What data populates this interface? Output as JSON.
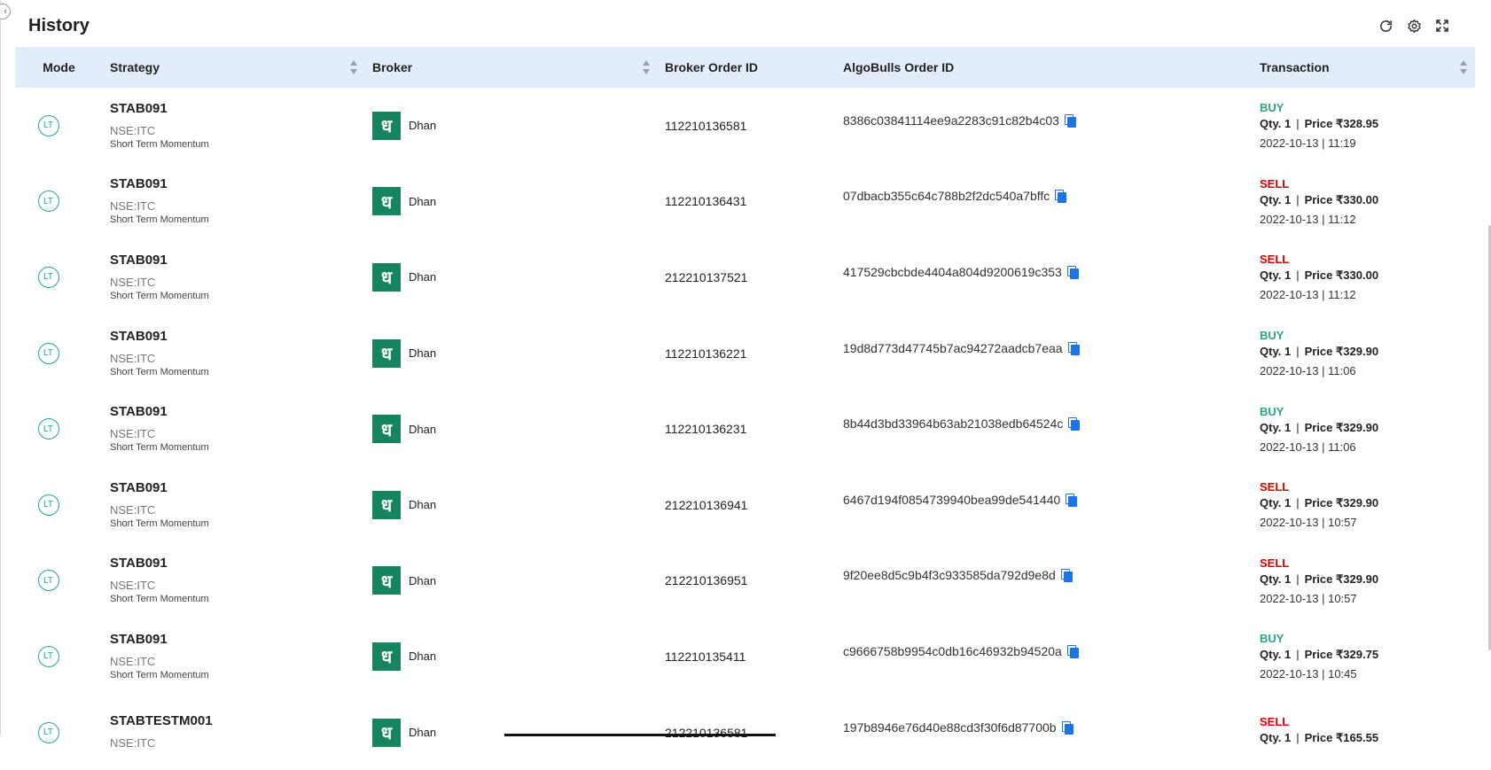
{
  "title": "History",
  "header_icons": [
    "refresh-icon",
    "gear-icon",
    "fullscreen-icon"
  ],
  "colors": {
    "header_bg": "#e3ecfa",
    "buy": "#2aa876",
    "sell": "#e00000",
    "broker_logo": "#16855d",
    "mode_badge": "#1fa59b",
    "copy_icon": "#1a73e8"
  },
  "columns": {
    "mode": "Mode",
    "strategy": "Strategy",
    "broker": "Broker",
    "broker_order_id": "Broker Order ID",
    "algobulls_order_id": "AlgoBulls Order ID",
    "transaction": "Transaction"
  },
  "qty_label": "Qty.",
  "price_label": "Price",
  "rows": [
    {
      "mode": "LT",
      "strategy": "STAB091",
      "instrument": "NSE:ITC",
      "description": "Short Term Momentum",
      "broker_glyph": "ध",
      "broker": "Dhan",
      "broker_order_id": "112210136581",
      "algobulls_order_id": "8386c03841114ee9a2283c91c82b4c03",
      "type": "BUY",
      "qty": "1",
      "price": "₹328.95",
      "datetime": "2022-10-13 | 11:19"
    },
    {
      "mode": "LT",
      "strategy": "STAB091",
      "instrument": "NSE:ITC",
      "description": "Short Term Momentum",
      "broker_glyph": "ध",
      "broker": "Dhan",
      "broker_order_id": "112210136431",
      "algobulls_order_id": "07dbacb355c64c788b2f2dc540a7bffc",
      "type": "SELL",
      "qty": "1",
      "price": "₹330.00",
      "datetime": "2022-10-13 | 11:12"
    },
    {
      "mode": "LT",
      "strategy": "STAB091",
      "instrument": "NSE:ITC",
      "description": "Short Term Momentum",
      "broker_glyph": "ध",
      "broker": "Dhan",
      "broker_order_id": "212210137521",
      "algobulls_order_id": "417529cbcbde4404a804d9200619c353",
      "type": "SELL",
      "qty": "1",
      "price": "₹330.00",
      "datetime": "2022-10-13 | 11:12"
    },
    {
      "mode": "LT",
      "strategy": "STAB091",
      "instrument": "NSE:ITC",
      "description": "Short Term Momentum",
      "broker_glyph": "ध",
      "broker": "Dhan",
      "broker_order_id": "112210136221",
      "algobulls_order_id": "19d8d773d47745b7ac94272aadcb7eaa",
      "type": "BUY",
      "qty": "1",
      "price": "₹329.90",
      "datetime": "2022-10-13 | 11:06"
    },
    {
      "mode": "LT",
      "strategy": "STAB091",
      "instrument": "NSE:ITC",
      "description": "Short Term Momentum",
      "broker_glyph": "ध",
      "broker": "Dhan",
      "broker_order_id": "112210136231",
      "algobulls_order_id": "8b44d3bd33964b63ab21038edb64524c",
      "type": "BUY",
      "qty": "1",
      "price": "₹329.90",
      "datetime": "2022-10-13 | 11:06"
    },
    {
      "mode": "LT",
      "strategy": "STAB091",
      "instrument": "NSE:ITC",
      "description": "Short Term Momentum",
      "broker_glyph": "ध",
      "broker": "Dhan",
      "broker_order_id": "212210136941",
      "algobulls_order_id": "6467d194f0854739940bea99de541440",
      "type": "SELL",
      "qty": "1",
      "price": "₹329.90",
      "datetime": "2022-10-13 | 10:57"
    },
    {
      "mode": "LT",
      "strategy": "STAB091",
      "instrument": "NSE:ITC",
      "description": "Short Term Momentum",
      "broker_glyph": "ध",
      "broker": "Dhan",
      "broker_order_id": "212210136951",
      "algobulls_order_id": "9f20ee8d5c9b4f3c933585da792d9e8d",
      "type": "SELL",
      "qty": "1",
      "price": "₹329.90",
      "datetime": "2022-10-13 | 10:57"
    },
    {
      "mode": "LT",
      "strategy": "STAB091",
      "instrument": "NSE:ITC",
      "description": "Short Term Momentum",
      "broker_glyph": "ध",
      "broker": "Dhan",
      "broker_order_id": "112210135411",
      "algobulls_order_id": "c9666758b9954c0db16c46932b94520a",
      "type": "BUY",
      "qty": "1",
      "price": "₹329.75",
      "datetime": "2022-10-13 | 10:45"
    },
    {
      "mode": "LT",
      "strategy": "STABTESTM001",
      "instrument": "NSE:ITC",
      "description": "",
      "broker_glyph": "ध",
      "broker": "Dhan",
      "broker_order_id": "212210136581",
      "algobulls_order_id": "197b8946e76d40e88cd3f30f6d87700b",
      "type": "SELL",
      "qty": "1",
      "price": "₹165.55",
      "datetime": ""
    }
  ]
}
